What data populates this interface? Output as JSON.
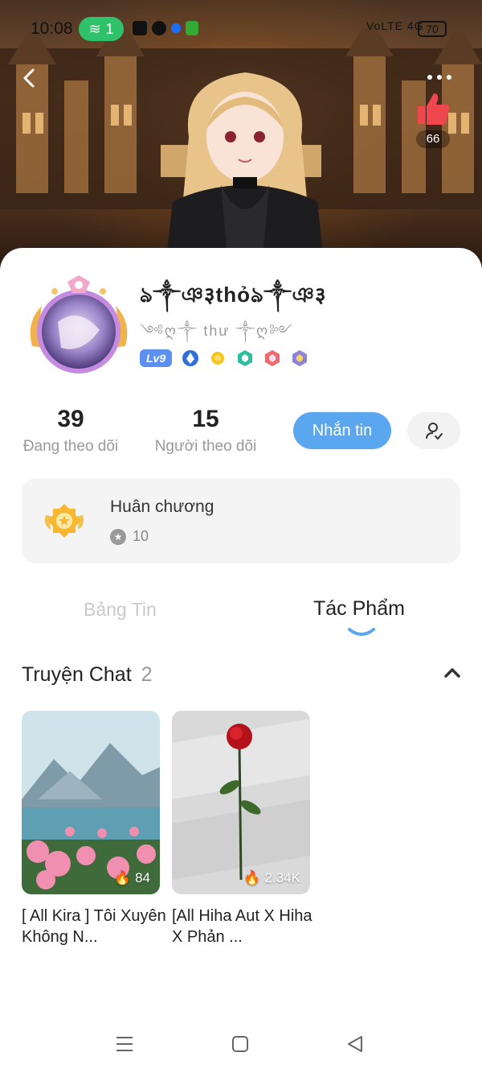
{
  "status_bar": {
    "time": "10:08",
    "wifi_count": "1",
    "signal": "VoLTE 4G",
    "battery": "70"
  },
  "header": {
    "like_count": "66"
  },
  "profile": {
    "username": "ঌ༒ঞ३thỏঌ༒ঞ३",
    "subname": "༺ღ༒ thư ༒ღ༻",
    "level": "Lv9",
    "following_count": "39",
    "following_label": "Đang theo dõi",
    "followers_count": "15",
    "followers_label": "Người theo dõi",
    "message_button": "Nhắn tin"
  },
  "medals": {
    "title": "Huân chương",
    "count": "10"
  },
  "tabs": {
    "feed": "Bảng Tin",
    "works": "Tác Phẩm"
  },
  "section": {
    "title": "Truyện Chat",
    "count": "2"
  },
  "stories": [
    {
      "title": "[ All Kira ] Tôi Xuyên Không N...",
      "views": "84"
    },
    {
      "title": "[All Hiha Aut X Hiha X Phản ...",
      "views": "2.34K"
    }
  ],
  "colors": {
    "accent": "#5aa7f0",
    "level_badge": "#5b8ff0",
    "like": "#f0474f"
  }
}
